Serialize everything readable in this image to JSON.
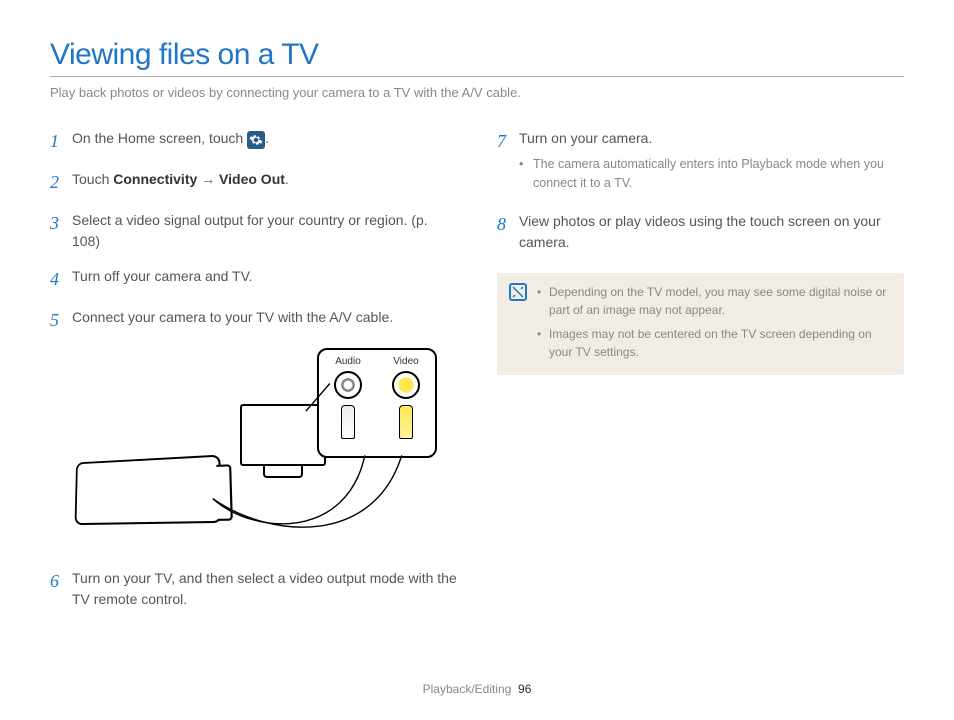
{
  "title": "Viewing files on a TV",
  "intro": "Play back photos or videos by connecting your camera to a TV with the A/V cable.",
  "diagram": {
    "audio_label": "Audio",
    "video_label": "Video"
  },
  "left_steps": [
    {
      "n": "1",
      "text_before": "On the Home screen, touch ",
      "has_icon": true,
      "text_after": "."
    },
    {
      "n": "2",
      "text_before": "Touch ",
      "bold1": "Connectivity",
      "arrow": " → ",
      "bold2": "Video Out",
      "text_after": "."
    },
    {
      "n": "3",
      "text_before": "Select a video signal output for your country or region. (p. 108)"
    },
    {
      "n": "4",
      "text_before": "Turn off your camera and TV."
    },
    {
      "n": "5",
      "text_before": "Connect your camera to your TV with the A/V cable."
    },
    {
      "n": "6",
      "text_before": "Turn on your TV, and then select a video output mode with the TV remote control."
    }
  ],
  "right_steps": [
    {
      "n": "7",
      "text_before": "Turn on your camera.",
      "subs": [
        "The camera automatically enters into Playback mode when you connect it to a TV."
      ]
    },
    {
      "n": "8",
      "text_before": "View photos or play videos using the touch screen on your camera."
    }
  ],
  "notes": [
    "Depending on the TV model, you may see some digital noise or part of an image may not appear.",
    "Images may not be centered on the TV screen depending on your TV settings."
  ],
  "footer": {
    "section": "Playback/Editing",
    "page": "96"
  }
}
